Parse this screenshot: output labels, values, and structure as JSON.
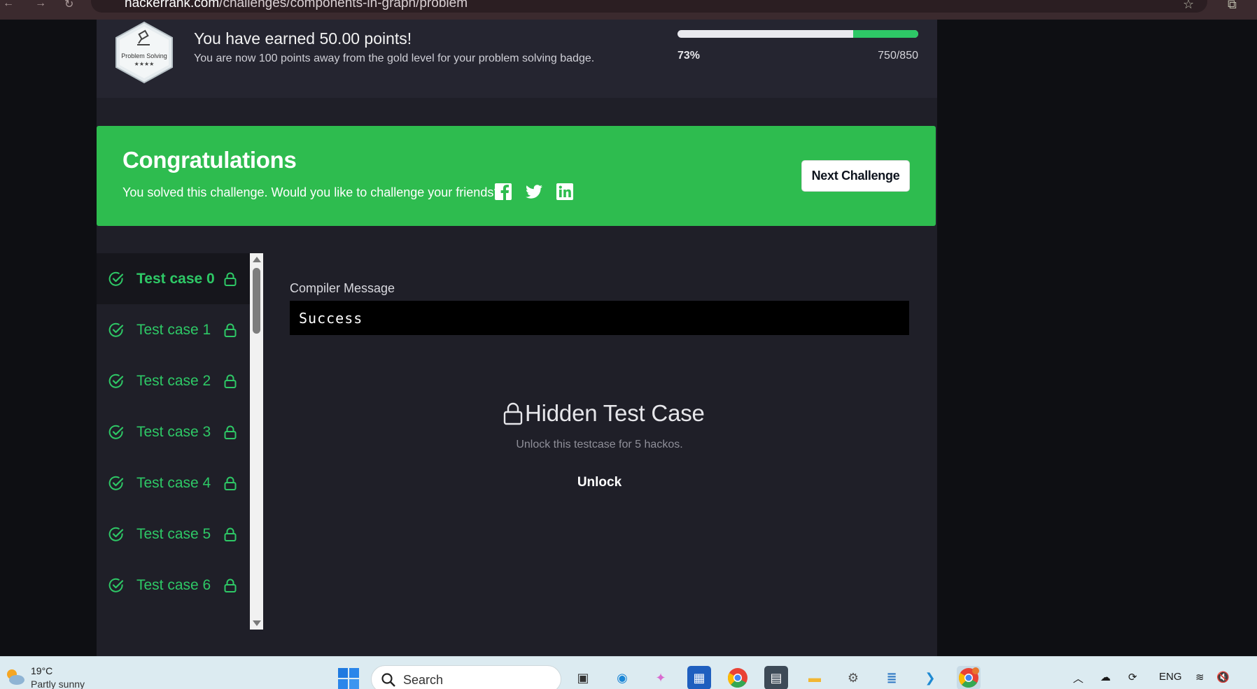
{
  "browser": {
    "url_host": "hackerrank.com",
    "url_path": "/challenges/components-in-graph/problem"
  },
  "badge": {
    "name": "Problem Solving",
    "stars": "★★★★",
    "earned_title": "You have earned 50.00 points!",
    "earned_sub": "You are now 100 points away from the gold level for your problem solving badge.",
    "progress_percent_label": "73%",
    "progress_count": "750/850",
    "progress_fraction": 0.27
  },
  "congrats": {
    "title": "Congratulations",
    "subtitle": "You solved this challenge. Would you like to challenge your friends?",
    "next_button": "Next Challenge",
    "share_icons": [
      "facebook-icon",
      "twitter-icon",
      "linkedin-icon"
    ]
  },
  "test_cases": [
    {
      "label": "Test case 0",
      "active": true
    },
    {
      "label": "Test case 1",
      "active": false
    },
    {
      "label": "Test case 2",
      "active": false
    },
    {
      "label": "Test case 3",
      "active": false
    },
    {
      "label": "Test case 4",
      "active": false
    },
    {
      "label": "Test case 5",
      "active": false
    },
    {
      "label": "Test case 6",
      "active": false
    }
  ],
  "compiler": {
    "label": "Compiler Message",
    "message": "Success"
  },
  "hidden_case": {
    "title": "Hidden Test Case",
    "subtitle": "Unlock this testcase for 5 hackos.",
    "unlock": "Unlock"
  },
  "taskbar": {
    "weather_temp": "19°C",
    "weather_desc": "Partly sunny",
    "search_placeholder": "Search",
    "language": "ENG"
  },
  "colors": {
    "accent_green": "#2ec866",
    "banner_green": "#2ebc4f",
    "panel": "#1f1f28"
  }
}
